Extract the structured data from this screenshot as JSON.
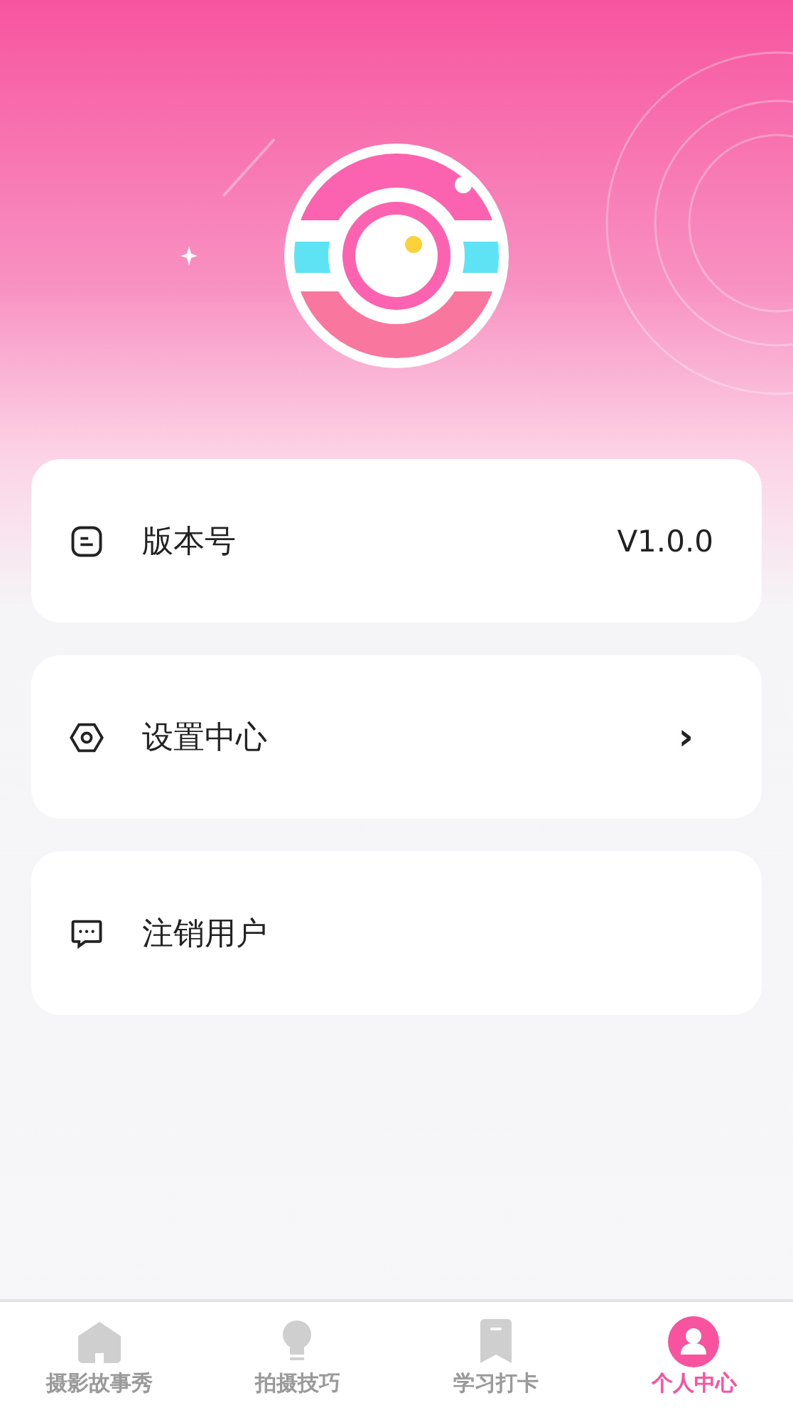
{
  "menu": [
    {
      "kind": "value",
      "label": "版本号",
      "value": "V1.0.0"
    },
    {
      "kind": "link",
      "label": "设置中心",
      "arrow": "›"
    },
    {
      "kind": "plain",
      "label": "注销用户"
    }
  ],
  "tabs": [
    {
      "label": "摄影故事秀",
      "selected": false
    },
    {
      "label": "拍摄技巧",
      "selected": false
    },
    {
      "label": "学习打卡",
      "selected": false
    },
    {
      "label": "个人中心",
      "selected": true
    }
  ]
}
